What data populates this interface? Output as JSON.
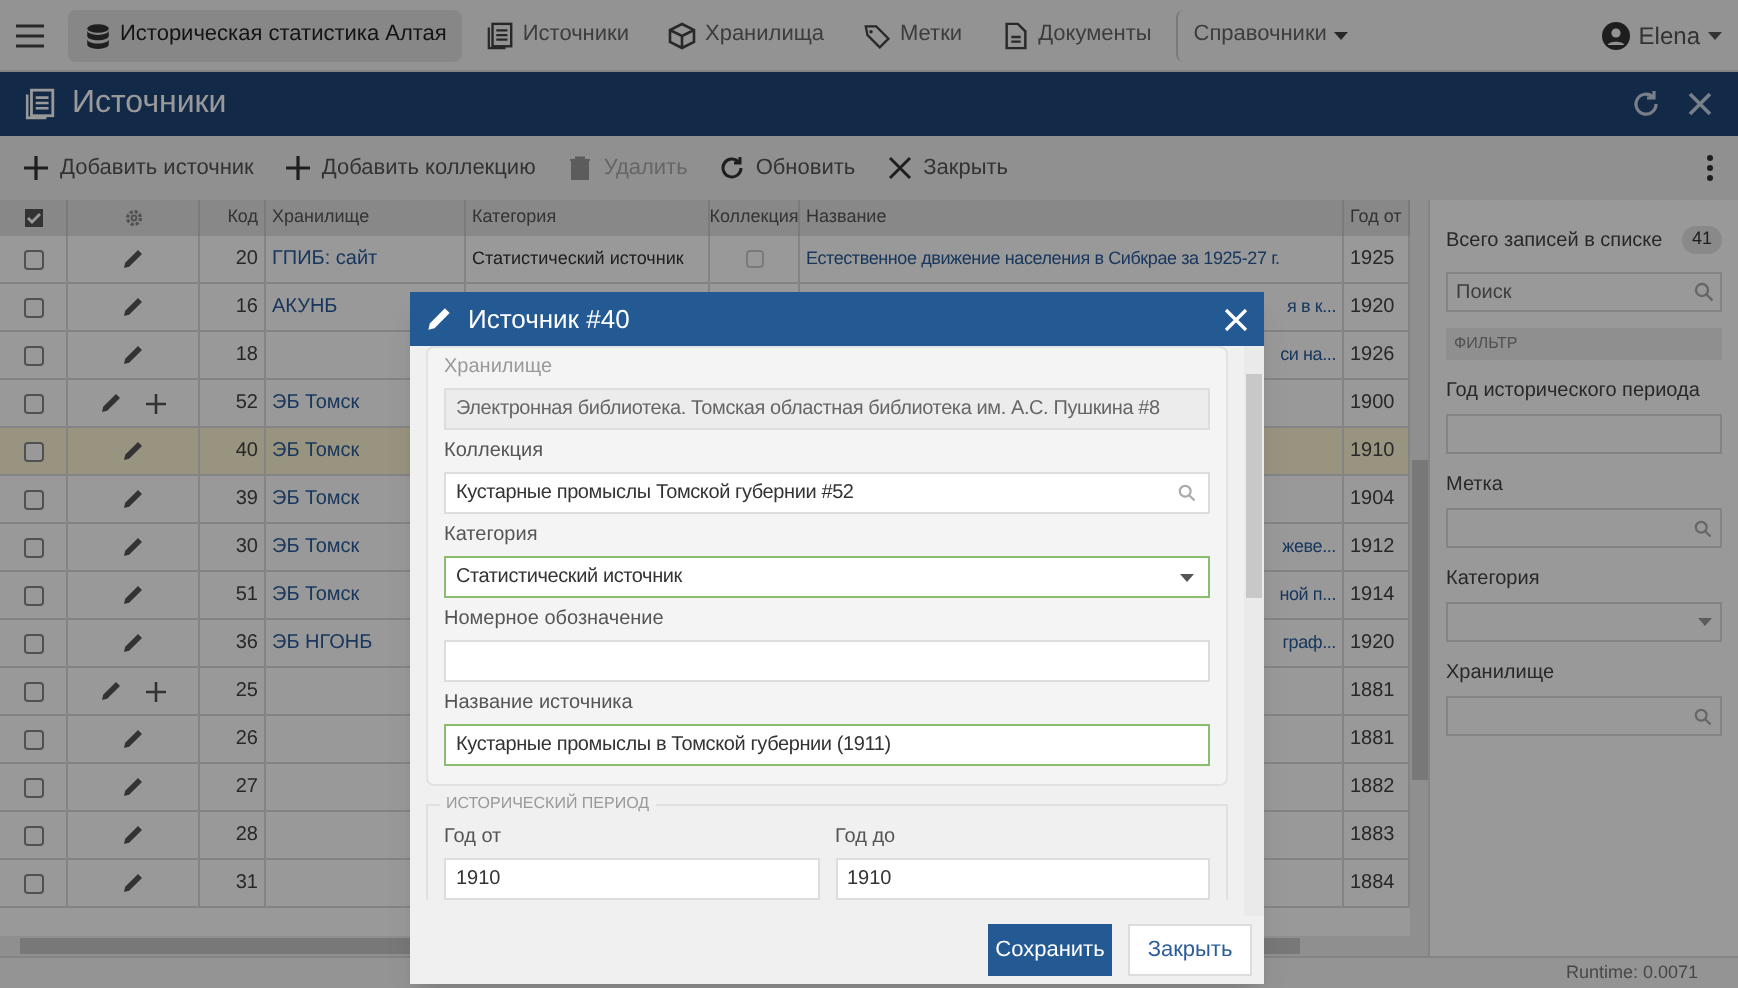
{
  "nav": {
    "items": [
      {
        "label": "Историческая статистика Алтая",
        "kind": "database",
        "selected": true
      },
      {
        "label": "Источники",
        "kind": "list",
        "selected": false
      },
      {
        "label": "Хранилища",
        "kind": "box",
        "selected": false
      },
      {
        "label": "Метки",
        "kind": "tag",
        "selected": false
      },
      {
        "label": "Документы",
        "kind": "file",
        "selected": false
      },
      {
        "label": "Справочники",
        "kind": "dropdown",
        "selected": false
      }
    ],
    "user": "Elena"
  },
  "page_header": {
    "title": "Источники"
  },
  "toolbar": {
    "buttons": [
      {
        "label": "Добавить источник",
        "kind": "add",
        "disabled": false
      },
      {
        "label": "Добавить коллекцию",
        "kind": "add",
        "disabled": false
      },
      {
        "label": "Удалить",
        "kind": "delete",
        "disabled": true
      },
      {
        "label": "Обновить",
        "kind": "refresh",
        "disabled": false
      },
      {
        "label": "Закрыть",
        "kind": "close",
        "disabled": false
      }
    ]
  },
  "table": {
    "columns": [
      "Код",
      "Хранилище",
      "Категория",
      "Коллекция",
      "Название",
      "Год от"
    ],
    "rows": [
      {
        "checked": false,
        "selected": false,
        "can_add": false,
        "code": "20",
        "storage": "ГПИБ: сайт",
        "category": "Статистический источник",
        "collection": {
          "checked": false
        },
        "title": "Естественное движение населения в Сибкрае за 1925-27 г.",
        "year": "1925"
      },
      {
        "checked": false,
        "selected": false,
        "can_add": false,
        "code": "16",
        "storage": "АКУНБ",
        "title": "я в к...",
        "year": "1920"
      },
      {
        "checked": false,
        "selected": false,
        "can_add": false,
        "code": "18",
        "title": "си на...",
        "year": "1926"
      },
      {
        "checked": false,
        "selected": false,
        "can_add": true,
        "code": "52",
        "storage": "ЭБ Томск",
        "year": "1900"
      },
      {
        "checked": false,
        "selected": true,
        "can_add": false,
        "code": "40",
        "storage": "ЭБ Томск",
        "year": "1910"
      },
      {
        "checked": false,
        "selected": false,
        "can_add": false,
        "code": "39",
        "storage": "ЭБ Томск",
        "year": "1904"
      },
      {
        "checked": false,
        "selected": false,
        "can_add": false,
        "code": "30",
        "storage": "ЭБ Томск",
        "title": "жеве...",
        "year": "1912"
      },
      {
        "checked": false,
        "selected": false,
        "can_add": false,
        "code": "51",
        "storage": "ЭБ Томск",
        "title": "ной п...",
        "year": "1914"
      },
      {
        "checked": false,
        "selected": false,
        "can_add": false,
        "code": "36",
        "storage": "ЭБ НГОНБ",
        "title": "граф...",
        "year": "1920"
      },
      {
        "checked": false,
        "selected": false,
        "can_add": true,
        "code": "25",
        "year": "1881"
      },
      {
        "checked": false,
        "selected": false,
        "can_add": false,
        "code": "26",
        "year": "1881"
      },
      {
        "checked": false,
        "selected": false,
        "can_add": false,
        "code": "27",
        "year": "1882"
      },
      {
        "checked": false,
        "selected": false,
        "can_add": false,
        "code": "28",
        "year": "1883"
      },
      {
        "checked": false,
        "selected": false,
        "can_add": false,
        "code": "31",
        "year": "1884"
      }
    ]
  },
  "sidebar": {
    "total_label": "Всего записей в списке",
    "total": "41",
    "search": {
      "placeholder": "Поиск"
    },
    "filter_title": "ФИЛЬТР",
    "filters": [
      {
        "label": "Год исторического периода",
        "kind": "text"
      },
      {
        "label": "Метка",
        "kind": "search"
      },
      {
        "label": "Категория",
        "kind": "select"
      },
      {
        "label": "Хранилище",
        "kind": "search"
      }
    ]
  },
  "status_bar": {
    "runtime": "Runtime: 0.0071"
  },
  "modal": {
    "title": "Источник #40",
    "fields": [
      {
        "label": "Хранилище",
        "value": "Электронная библиотека. Томская областная библиотека им. А.С. Пушкина #8",
        "kind": "text",
        "disabled": true,
        "valid": false
      },
      {
        "label": "Коллекция",
        "value": "Кустарные промыслы Томской губернии #52",
        "kind": "search",
        "disabled": false,
        "valid": false
      },
      {
        "label": "Категория",
        "value": "Статистический источник",
        "kind": "select",
        "disabled": false,
        "valid": true
      },
      {
        "label": "Номерное обозначение",
        "kind": "text",
        "disabled": false,
        "valid": false
      },
      {
        "label": "Название источника",
        "value": "Кустарные промыслы в Томской губернии (1911)",
        "kind": "text",
        "disabled": false,
        "valid": true
      }
    ],
    "period": {
      "title": "ИСТОРИЧЕСКИЙ ПЕРИОД",
      "fields": [
        {
          "label": "Год от",
          "value": "1910"
        },
        {
          "label": "Год до",
          "value": "1910"
        }
      ]
    },
    "buttons": [
      {
        "label": "Сохранить",
        "kind": "primary"
      },
      {
        "label": "Закрыть",
        "kind": "secondary"
      }
    ]
  }
}
